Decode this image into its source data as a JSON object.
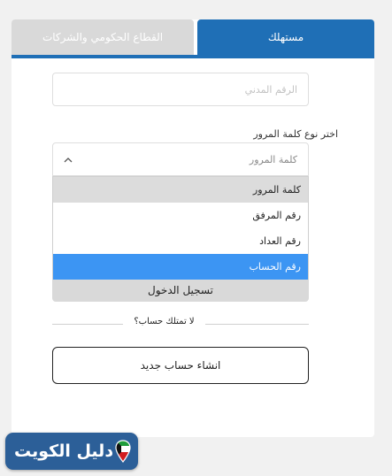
{
  "tabs": {
    "business": "القطاع الحكومي والشركات",
    "consumer": "مستهلك"
  },
  "form": {
    "civil_id_placeholder": "الرقم المدني",
    "password_type_label": "اختر نوع كلمة المرور",
    "password_type_selected": "كلمة المرور",
    "options": [
      "كلمة المرور",
      "رقم المرفق",
      "رقم العداد",
      "رقم الحساب"
    ],
    "login_button": "تسجيل الدخول",
    "no_account_text": "لا تمتلك حساب؟",
    "create_account_button": "انشاء حساب جديد"
  },
  "logo": {
    "text": "دليل الكويت"
  },
  "colors": {
    "accent": "#1f6fb6",
    "selected_option": "#3c95f3",
    "hover_option": "#dcdcdc",
    "inactive_tab": "#d9d9d9",
    "logo_bg": "#2c5f98"
  }
}
